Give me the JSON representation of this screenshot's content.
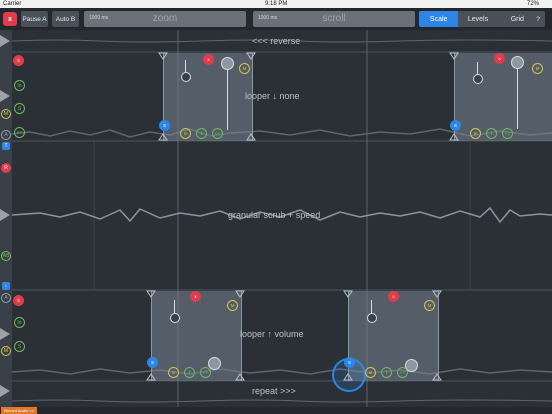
{
  "status_bar": {
    "carrier": "Carrier",
    "time": "9:18 PM",
    "battery": "72%"
  },
  "toolbar": {
    "close_label": "x",
    "pause_label": "Pause A",
    "auto_label": "Auto B",
    "zoom": {
      "ms": "1000 ms",
      "title": "zoom"
    },
    "scroll": {
      "ms": "1000 ms",
      "title": "scroll"
    },
    "tabs": [
      "Scale",
      "Levels",
      "Grid"
    ],
    "active_tab": "Scale",
    "help_label": "?"
  },
  "tracks": {
    "reverse_label": "<<< reverse",
    "looper_none_label": "looper ↓ none",
    "granular_label": "granular scrub + speed",
    "looper_volume_label": "looper ↑ volume",
    "repeat_label": "repeat >>>"
  },
  "left_buttons": {
    "a_top": "A",
    "t": "T",
    "r": "R",
    "ab": "AB",
    "down": "↓",
    "a_bottom": "A",
    "m1": "M",
    "m2": "M",
    "in1": "In",
    "in2": "In",
    "s1": "S",
    "s2": "S",
    "rev": "<<",
    "x1": "x",
    "x2": "x"
  },
  "loop_controls": {
    "s_label": "S",
    "in_label": "In",
    "split_label": "‖",
    "rev_label": "<<",
    "m_label": "M",
    "x_label": "x"
  },
  "bottom_button": "Record Audio >>",
  "colors": {
    "accent": "#2d86e5",
    "red": "#e23b4c",
    "yellow": "#d4c44a",
    "green": "#6dbb5a"
  }
}
